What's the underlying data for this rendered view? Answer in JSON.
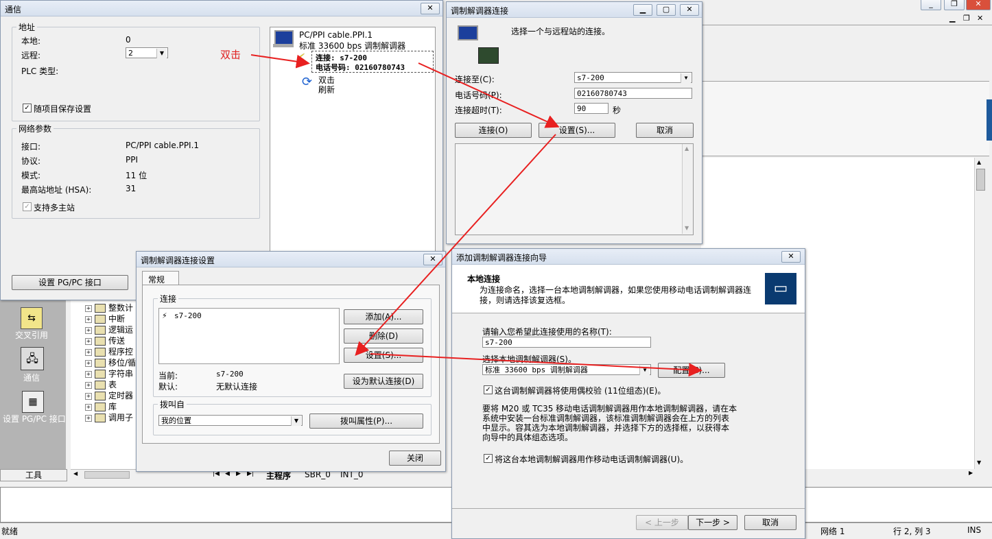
{
  "comm": {
    "title": "通信",
    "close": "☒",
    "address_group": "地址",
    "local_label": "本地:",
    "local_value": "0",
    "remote_label": "远程:",
    "remote_value": "2",
    "plc_type_label": "PLC 类型:",
    "save_with_project": "随项目保存设置",
    "net_group": "网络参数",
    "iface_label": "接口:",
    "iface_value": "PC/PPI cable.PPI.1",
    "proto_label": "协议:",
    "proto_value": "PPI",
    "mode_label": "模式:",
    "mode_value": "11 位",
    "hsa_label": "最高站地址 (HSA):",
    "hsa_value": "31",
    "multi_master": "支持多主站",
    "set_pgpc_button": "设置 PG/PC 接口",
    "tree_item1": "PC/PPI cable.PPI.1",
    "tree_item2": "标准 33600 bps 调制解调器",
    "conn_label": "连接: s7-200",
    "phone_label": "电话号码: 02160780743",
    "dbl_click": "双击",
    "refresh": "刷新",
    "annotation": "双击"
  },
  "modem_conn": {
    "title": "调制解调器连接",
    "prompt": "选择一个与远程站的连接。",
    "connect_to_label": "连接至(C):",
    "connect_to_value": "s7-200",
    "phone_label": "电话号码(P):",
    "phone_value": "02160780743",
    "timeout_label": "连接超时(T):",
    "timeout_value": "90",
    "seconds": "秒",
    "connect_button": "连接(O)",
    "settings_button": "设置(S)...",
    "cancel_button": "取消"
  },
  "modem_settings": {
    "title": "调制解调器连接设置",
    "tab_general": "常规",
    "conn_group": "连接",
    "list_item": "s7-200",
    "add_button": "添加(A)...",
    "delete_button": "删除(D)",
    "settings_button": "设置(S)...",
    "current_label": "当前:",
    "current_value": "s7-200",
    "default_label": "默认:",
    "default_value": "无默认连接",
    "set_default_button": "设为默认连接(D)",
    "dial_group": "拨叫自",
    "dial_value": "我的位置",
    "dial_props_button": "拨叫属性(P)...",
    "close_button": "关闭"
  },
  "wizard": {
    "title": "添加调制解调器连接向导",
    "heading": "本地连接",
    "desc1": "为连接命名，选择一台本地调制解调器，如果您使用移动电话调制解调器连",
    "desc2": "接，则请选择该复选框。",
    "name_prompt": "请输入您希望此连接使用的名称(T):",
    "name_value": "s7-200",
    "select_modem": "选择本地调制解调器(S)。",
    "modem_value": "标准 33600 bps 调制解调器",
    "config_button": "配置(C)...",
    "parity_check": "这台调制解调器将使用偶校验 (11位组态)(E)。",
    "info1": "要将 M20 或 TC35 移动电话调制解调器用作本地调制解调器，请在本",
    "info2": "系统中安装一台标准调制解调器，该标准调制解调器会在上方的列表",
    "info3": "中显示。容其选为本地调制解调器，并选择下方的选择框，以获得本",
    "info4": "向导中的具体组态选项。",
    "mobile_check": "将这台本地调制解调器用作移动电话调制解调器(U)。",
    "back_button": "< 上一步",
    "next_button": "下一步 >",
    "cancel_button": "取消"
  },
  "main": {
    "nav_cross_ref": "交叉引用",
    "nav_comm": "通信",
    "nav_set_pgpc": "设置 PG/PC 接口",
    "tools_tab": "工具",
    "tree": [
      "整数计",
      "中断",
      "逻辑运",
      "传送",
      "程序控",
      "移位/循",
      "字符串",
      "表",
      "定时器",
      "库",
      "调用子"
    ],
    "tab_main": "主程序",
    "tab_sbr": "SBR_0",
    "tab_int": "INT_0",
    "status_ready": "就绪",
    "status_net": "网络 1",
    "status_pos": "行 2, 列 3",
    "status_ins": "INS"
  }
}
